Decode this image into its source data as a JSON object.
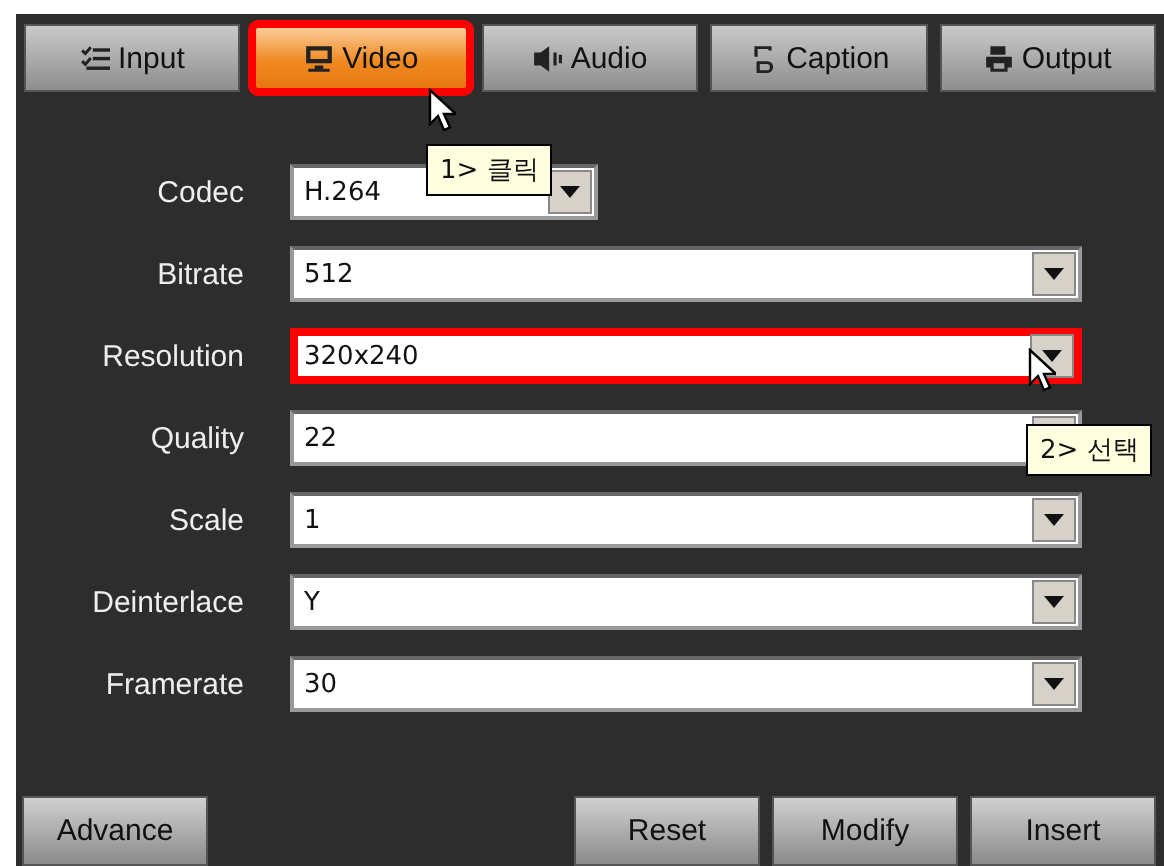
{
  "tabs": [
    {
      "label": "Input",
      "selected": false,
      "highlighted": false
    },
    {
      "label": "Video",
      "selected": true,
      "highlighted": true
    },
    {
      "label": "Audio",
      "selected": false,
      "highlighted": false
    },
    {
      "label": "Caption",
      "selected": false,
      "highlighted": false
    },
    {
      "label": "Output",
      "selected": false,
      "highlighted": false
    }
  ],
  "fields": [
    {
      "label": "Codec",
      "value": "H.264",
      "kind": "short",
      "highlighted": false
    },
    {
      "label": "Bitrate",
      "value": "512",
      "kind": "full",
      "highlighted": false
    },
    {
      "label": "Resolution",
      "value": "320x240",
      "kind": "full",
      "highlighted": true
    },
    {
      "label": "Quality",
      "value": "22",
      "kind": "full",
      "highlighted": false
    },
    {
      "label": "Scale",
      "value": "1",
      "kind": "full",
      "highlighted": false
    },
    {
      "label": "Deinterlace",
      "value": "Y",
      "kind": "full",
      "highlighted": false
    },
    {
      "label": "Framerate",
      "value": "30",
      "kind": "full",
      "highlighted": false
    }
  ],
  "left_buttons": [
    "Advance"
  ],
  "right_buttons": [
    "Reset",
    "Modify",
    "Insert"
  ],
  "callouts": [
    {
      "text": "1> 클릭"
    },
    {
      "text": "2> 선택"
    }
  ]
}
